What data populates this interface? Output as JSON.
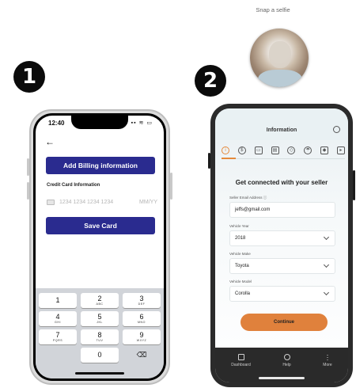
{
  "badges": {
    "step1": "1",
    "step2": "2"
  },
  "selfie": {
    "caption": "Snap a selfie"
  },
  "phone1": {
    "time": "12:40",
    "status_icons": "▪▪ ≋ ▭",
    "back_icon": "←",
    "billing_button": "Add Billing information",
    "cc_section_label": "Credit Card Information",
    "cc_number_placeholder": "1234 1234 1234 1234",
    "cc_expiry_placeholder": "MM/YY",
    "save_button": "Save Card",
    "keypad": [
      [
        {
          "d": "1",
          "l": ""
        },
        {
          "d": "2",
          "l": "ABC"
        },
        {
          "d": "3",
          "l": "DEF"
        }
      ],
      [
        {
          "d": "4",
          "l": "GHI"
        },
        {
          "d": "5",
          "l": "JKL"
        },
        {
          "d": "6",
          "l": "MNO"
        }
      ],
      [
        {
          "d": "7",
          "l": "PQRS"
        },
        {
          "d": "8",
          "l": "TUV"
        },
        {
          "d": "9",
          "l": "WXYZ"
        }
      ]
    ],
    "zero_key": "0",
    "delete_key": "⌫"
  },
  "phone2": {
    "title": "Information",
    "step_icons": [
      "i",
      "$",
      "▭",
      "▤",
      "◇",
      "☂",
      "◆",
      "▸"
    ],
    "heading": "Get connected with your seller",
    "email_label": "Seller Email Address ⓘ",
    "email_value": "jeffs@gmail.com",
    "year_label": "Vehicle Year",
    "year_value": "2018",
    "make_label": "Vehicle Make",
    "make_value": "Toyota",
    "model_label": "Vehicle Model",
    "model_value": "Corolla",
    "continue_button": "Continue",
    "nav": [
      "Dashboard",
      "Help",
      "More"
    ]
  },
  "colors": {
    "primary_blue": "#2a2b8f",
    "accent_orange": "#e0813c"
  }
}
